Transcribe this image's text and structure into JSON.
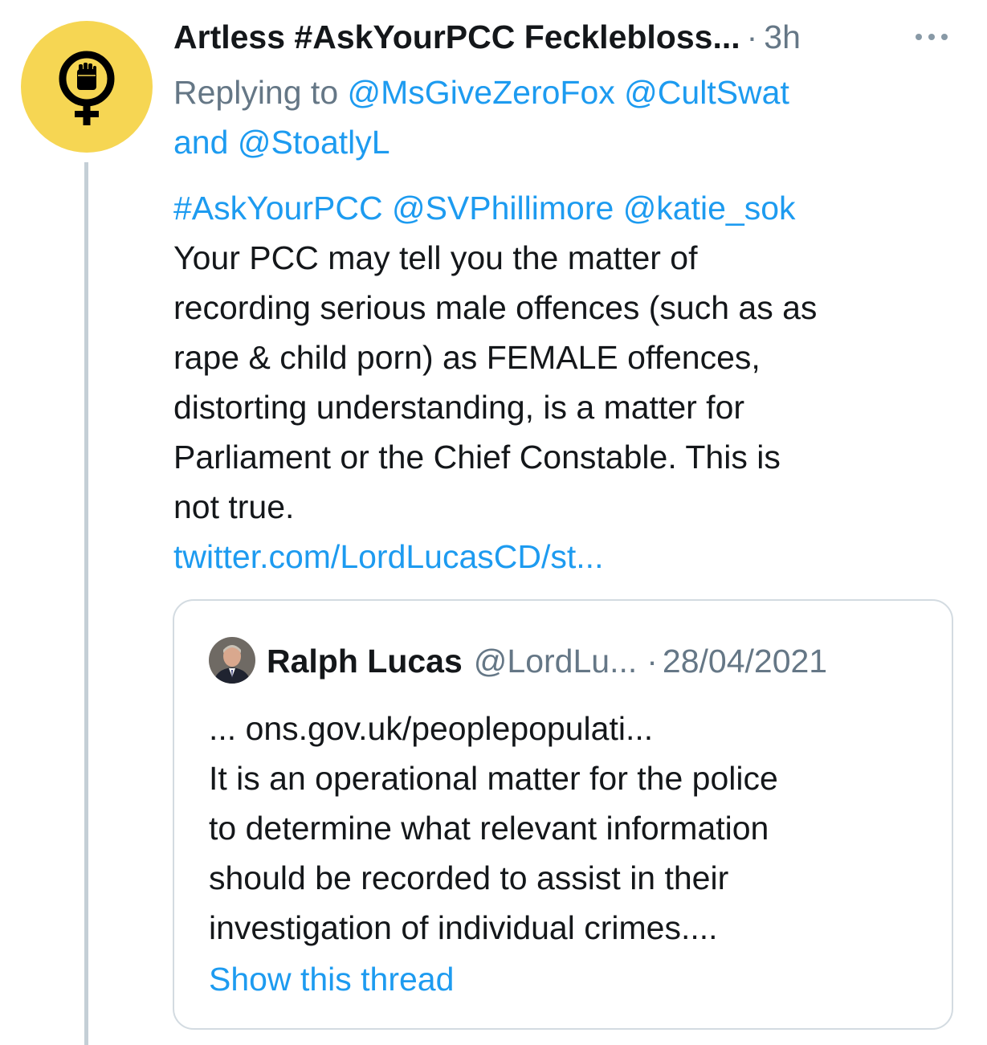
{
  "tweet": {
    "author_name": "Artless #AskYourPCC Fecklebloss...",
    "separator": "·",
    "time": "3h",
    "replying_prefix": "Replying to",
    "reply_handle_1": "@MsGiveZeroFox",
    "reply_handle_2": "@CultSwat",
    "reply_and": "and",
    "reply_handle_3": "@StoatlyL",
    "mention_hashtag": "#AskYourPCC",
    "mention_1": "@SVPhillimore",
    "mention_2": "@katie_sok",
    "body_lines": [
      "Your PCC may tell you the matter of",
      "recording serious male offences (such as as",
      "rape & child porn) as FEMALE offences,",
      "distorting understanding, is a matter for",
      "Parliament or the Chief Constable. This is",
      "not true."
    ],
    "link": "twitter.com/LordLucasCD/st..."
  },
  "quoted": {
    "author_name": "Ralph Lucas",
    "handle": "@LordLu...",
    "separator": "·",
    "date": "28/04/2021",
    "text_lines": [
      "... ons.gov.uk/peoplepopulati...",
      "It is an operational matter for the police",
      "to determine what relevant information",
      "should be recorded to assist in their",
      "investigation of individual crimes...."
    ],
    "show_thread": "Show this thread"
  },
  "colors": {
    "link": "#1d9bf0",
    "muted": "#657786",
    "avatar_bg": "#f6d653",
    "thread_line": "#c4cfd6"
  },
  "icons": {
    "author_avatar": "female-symbol-raised-fist-icon",
    "more": "more-options-icon"
  }
}
